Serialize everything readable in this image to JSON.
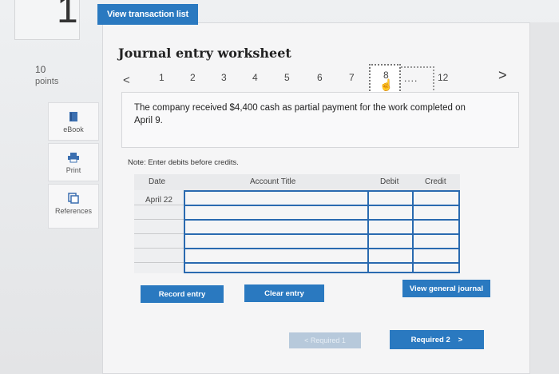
{
  "question": {
    "number": "1",
    "points_value": "10",
    "points_label": "points"
  },
  "tools": [
    {
      "label": "eBook",
      "icon": "book-icon"
    },
    {
      "label": "Print",
      "icon": "printer-icon"
    },
    {
      "label": "References",
      "icon": "references-icon"
    }
  ],
  "top_button": "View transaction list",
  "title": "Journal entry worksheet",
  "pager": {
    "prev": "<",
    "next": ">",
    "pages": [
      "1",
      "2",
      "3",
      "4",
      "5",
      "6",
      "7",
      "8"
    ],
    "current": "8",
    "ellipsis": "....",
    "last": "12"
  },
  "prompt": "The company received $4,400 cash as partial payment for the work completed on April 9.",
  "note": "Note: Enter debits before credits.",
  "table": {
    "headers": {
      "date": "Date",
      "account": "Account Title",
      "debit": "Debit",
      "credit": "Credit"
    },
    "date_value": "April 22"
  },
  "buttons": {
    "record": "Record entry",
    "clear": "Clear entry",
    "view_journal": "View general journal",
    "required1": "< Required 1",
    "required2": "Required 2",
    "required2_arrow": ">"
  },
  "colors": {
    "accent": "#2a79c0",
    "table_line": "#2a6ab0",
    "disabled": "#b7c9db"
  }
}
